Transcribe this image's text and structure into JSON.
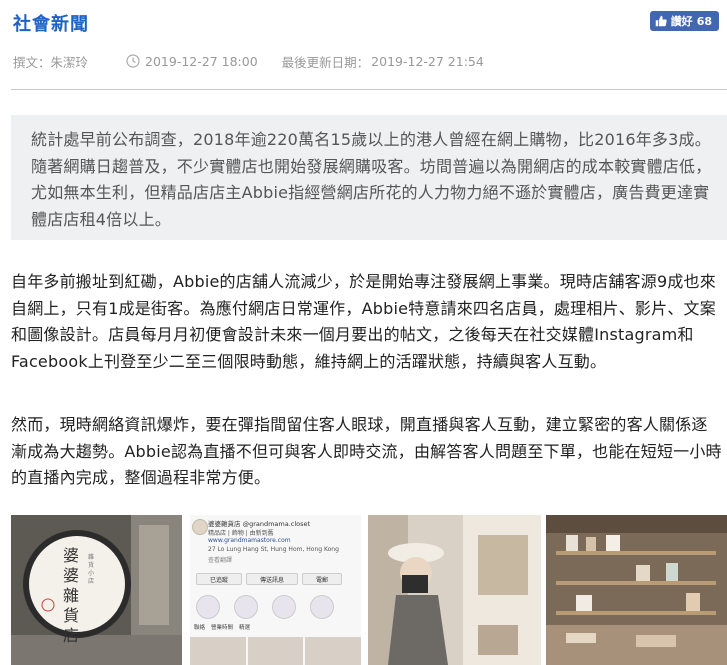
{
  "header": {
    "category": "社會新聞",
    "like_label": "讚好",
    "like_count": "68"
  },
  "meta": {
    "author": "撰文：朱潔玲",
    "published": "2019-12-27 18:00",
    "updated_label": "最後更新日期：",
    "updated": "2019-12-27 21:54"
  },
  "article": {
    "summary": "統計處早前公布調查，2018年逾220萬名15歲以上的港人曾經在網上購物，比2016年多3成。隨著網購日趨普及，不少實體店也開始發展網購吸客。坊間普遍以為開網店的成本較實體店低，尤如無本生利，但精品店店主Abbie指經營網店所花的人力物力絕不遜於實體店，廣告費更達實體店店租4倍以上。",
    "paragraph_1": "自年多前搬址到紅磡，Abbie的店舖人流減少，於是開始專注發展網上事業。現時店舖客源9成也來自網上，只有1成是街客。為應付網店日常運作，Abbie特意請來四名店員，處理相片、影片、文案和圖像設計。店員每月月初便會設計未來一個月要出的帖文，之後每天在社交媒體Instagram和Facebook上刊登至少二至三個限時動態，維持網上的活躍狀態，持續與客人互動。",
    "paragraph_2": "然而，現時網絡資訊爆炸，要在彈指間留住客人眼球，開直播與客人互動，建立緊密的客人關係逐漸成為大趨勢。Abbie認為直播不但可與客人即時交流，由解答客人問題至下單，也能在短短一小時的直播內完成，整個過程非常方便。"
  },
  "photos": {
    "sign_text": "婆婆雜貨店",
    "sign_sub": "雜貨小店",
    "ig_profile": {
      "name": "婆婆雜貨店 @grandmama.closet",
      "line1": "精品店 | 飾物 | 由新到舊",
      "line2": "www.grandmamastore.com",
      "line3": "27 Lo Lung Hang St, Hung Hom, Hong Kong",
      "line4": "查看翻譯",
      "buttons": [
        "已追蹤",
        "傳送訊息",
        "電郵"
      ],
      "highlights": [
        "聯絡",
        "營業時間",
        "精選"
      ]
    }
  },
  "colors": {
    "category": "#1e63c4",
    "like_bg": "#4267b2",
    "summary_bg": "#eef0f2",
    "meta_text": "#999999"
  }
}
